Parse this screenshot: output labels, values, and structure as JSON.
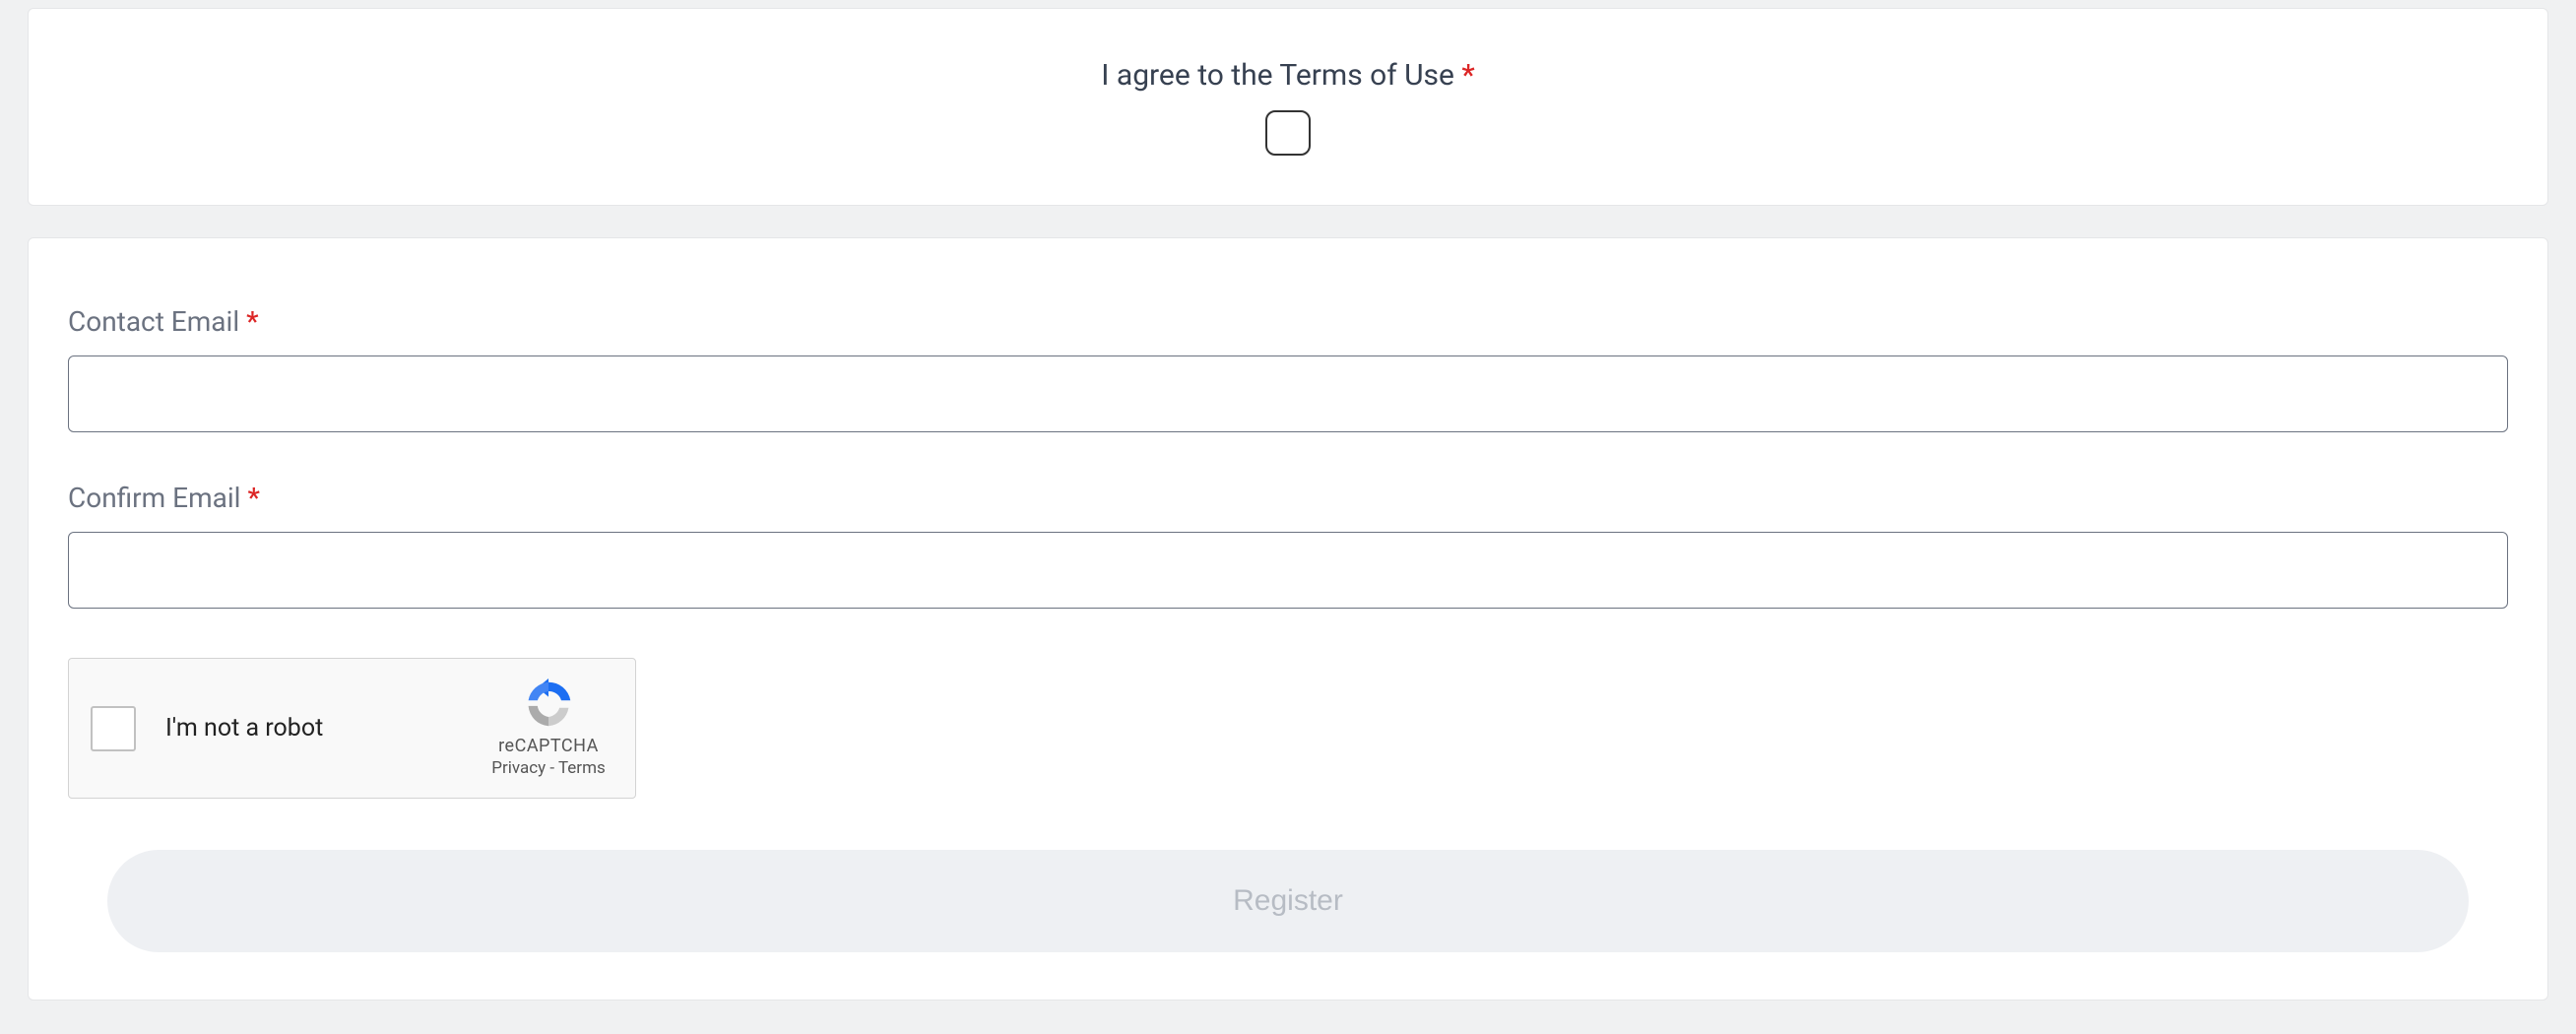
{
  "agreement": {
    "label": "I agree to the Terms of Use",
    "required_marker": "*"
  },
  "fields": {
    "contact_email": {
      "label": "Contact Email",
      "required_marker": "*",
      "value": ""
    },
    "confirm_email": {
      "label": "Confirm Email",
      "required_marker": "*",
      "value": ""
    }
  },
  "recaptcha": {
    "label": "I'm not a robot",
    "brand": "reCAPTCHA",
    "privacy": "Privacy",
    "separator": " - ",
    "terms": "Terms"
  },
  "submit": {
    "label": "Register"
  }
}
